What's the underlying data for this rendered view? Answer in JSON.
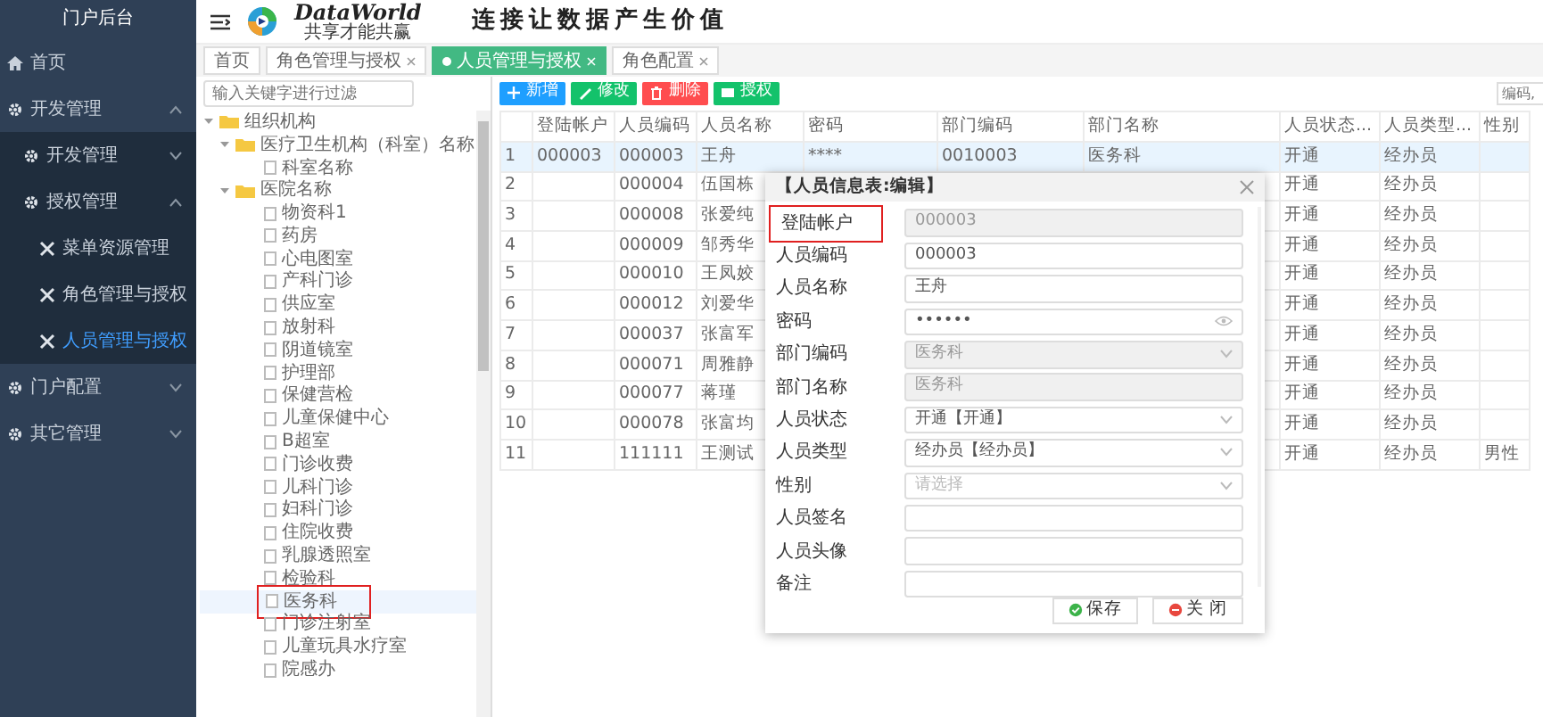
{
  "sidebar": {
    "title": "门户后台",
    "items": [
      {
        "label": "首页",
        "kind": "page"
      },
      {
        "label": "开发管理",
        "kind": "group",
        "expanded": true,
        "children": [
          {
            "label": "开发管理",
            "kind": "group",
            "expanded": false
          },
          {
            "label": "授权管理",
            "kind": "group",
            "expanded": true,
            "children": [
              {
                "label": "菜单资源管理",
                "kind": "function",
                "selected": false
              },
              {
                "label": "角色管理与授权",
                "kind": "function",
                "selected": false
              },
              {
                "label": "人员管理与授权",
                "kind": "function",
                "selected": true
              }
            ]
          }
        ]
      },
      {
        "label": "门户配置",
        "kind": "group",
        "expanded": false
      },
      {
        "label": "其它管理",
        "kind": "group",
        "expanded": false
      }
    ]
  },
  "header": {
    "logo": {
      "name": "DataWorld",
      "tagline": "共享才能共赢"
    },
    "slogan": "连接让数据产生价值"
  },
  "tabs": [
    {
      "label": "首页",
      "selected": false,
      "closable": false
    },
    {
      "label": "角色管理与授权",
      "selected": false,
      "closable": true
    },
    {
      "label": "人员管理与授权",
      "selected": true,
      "closable": true
    },
    {
      "label": "角色配置",
      "selected": false,
      "closable": true
    }
  ],
  "tree": {
    "filter_placeholder": "输入关键字进行过滤",
    "nodes": [
      {
        "label": "组织机构",
        "kind": "folder",
        "expanded": true,
        "children": [
          {
            "label": "医疗卫生机构（科室）名称",
            "kind": "folder",
            "expanded": true,
            "children": [
              {
                "label": "科室名称",
                "kind": "leaf",
                "selected": false,
                "highlighted": false
              }
            ]
          },
          {
            "label": "医院名称",
            "kind": "folder",
            "expanded": true,
            "children": [
              {
                "label": "物资科1",
                "kind": "leaf",
                "selected": false,
                "highlighted": false
              },
              {
                "label": "药房",
                "kind": "leaf",
                "selected": false,
                "highlighted": false
              },
              {
                "label": "心电图室",
                "kind": "leaf",
                "selected": false,
                "highlighted": false
              },
              {
                "label": "产科门诊",
                "kind": "leaf",
                "selected": false,
                "highlighted": false
              },
              {
                "label": "供应室",
                "kind": "leaf",
                "selected": false,
                "highlighted": false
              },
              {
                "label": "放射科",
                "kind": "leaf",
                "selected": false,
                "highlighted": false
              },
              {
                "label": "阴道镜室",
                "kind": "leaf",
                "selected": false,
                "highlighted": false
              },
              {
                "label": "护理部",
                "kind": "leaf",
                "selected": false,
                "highlighted": false
              },
              {
                "label": "保健营检",
                "kind": "leaf",
                "selected": false,
                "highlighted": false
              },
              {
                "label": "儿童保健中心",
                "kind": "leaf",
                "selected": false,
                "highlighted": false
              },
              {
                "label": "B超室",
                "kind": "leaf",
                "selected": false,
                "highlighted": false
              },
              {
                "label": "门诊收费",
                "kind": "leaf",
                "selected": false,
                "highlighted": false
              },
              {
                "label": "儿科门诊",
                "kind": "leaf",
                "selected": false,
                "highlighted": false
              },
              {
                "label": "妇科门诊",
                "kind": "leaf",
                "selected": false,
                "highlighted": false
              },
              {
                "label": "住院收费",
                "kind": "leaf",
                "selected": false,
                "highlighted": false
              },
              {
                "label": "乳腺透照室",
                "kind": "leaf",
                "selected": false,
                "highlighted": false
              },
              {
                "label": "检验科",
                "kind": "leaf",
                "selected": false,
                "highlighted": false
              },
              {
                "label": "医务科",
                "kind": "leaf",
                "selected": true,
                "highlighted": true
              },
              {
                "label": "门诊注射室",
                "kind": "leaf",
                "selected": false,
                "highlighted": false
              },
              {
                "label": "儿童玩具水疗室",
                "kind": "leaf",
                "selected": false,
                "highlighted": false
              },
              {
                "label": "院感办",
                "kind": "leaf",
                "selected": false,
                "highlighted": false
              }
            ]
          }
        ]
      }
    ]
  },
  "toolbar": {
    "buttons": [
      {
        "label": "新增",
        "kind": "add"
      },
      {
        "label": "修改",
        "kind": "edit"
      },
      {
        "label": "删除",
        "kind": "delete"
      },
      {
        "label": "授权",
        "kind": "grant"
      }
    ],
    "search_placeholder": "编码,"
  },
  "table": {
    "columns": [
      "登陆帐户",
      "人员编码",
      "人员名称",
      "密码",
      "部门编码",
      "部门名称",
      "人员状态...",
      "人员类型...",
      "性别"
    ],
    "rows": [
      {
        "index": "1",
        "selected": true,
        "cells": [
          "000003",
          "000003",
          "王舟",
          "****",
          "0010003",
          "医务科",
          "开通",
          "经办员",
          null
        ]
      },
      {
        "index": "2",
        "selected": false,
        "cells": [
          null,
          "000004",
          "伍国栋",
          null,
          null,
          null,
          "开通",
          "经办员",
          null
        ]
      },
      {
        "index": "3",
        "selected": false,
        "cells": [
          null,
          "000008",
          "张爱纯",
          null,
          null,
          null,
          "开通",
          "经办员",
          null
        ]
      },
      {
        "index": "4",
        "selected": false,
        "cells": [
          null,
          "000009",
          "邹秀华",
          null,
          null,
          null,
          "开通",
          "经办员",
          null
        ]
      },
      {
        "index": "5",
        "selected": false,
        "cells": [
          null,
          "000010",
          "王凤姣",
          null,
          null,
          null,
          "开通",
          "经办员",
          null
        ]
      },
      {
        "index": "6",
        "selected": false,
        "cells": [
          null,
          "000012",
          "刘爱华",
          null,
          null,
          null,
          "开通",
          "经办员",
          null
        ]
      },
      {
        "index": "7",
        "selected": false,
        "cells": [
          null,
          "000037",
          "张富军",
          null,
          null,
          null,
          "开通",
          "经办员",
          null
        ]
      },
      {
        "index": "8",
        "selected": false,
        "cells": [
          null,
          "000071",
          "周雅静",
          null,
          null,
          null,
          "开通",
          "经办员",
          null
        ]
      },
      {
        "index": "9",
        "selected": false,
        "cells": [
          null,
          "000077",
          "蒋瑾",
          null,
          null,
          null,
          "开通",
          "经办员",
          null
        ]
      },
      {
        "index": "10",
        "selected": false,
        "cells": [
          null,
          "000078",
          "张富均",
          null,
          null,
          null,
          "开通",
          "经办员",
          null
        ]
      },
      {
        "index": "11",
        "selected": false,
        "cells": [
          null,
          "111111",
          "王测试",
          null,
          null,
          null,
          "开通",
          "经办员",
          "男性"
        ]
      }
    ]
  },
  "dialog": {
    "title": "【人员信息表:编辑】",
    "fields": [
      {
        "label": "登陆帐户",
        "kind": "text",
        "value": "000003",
        "disabled": true,
        "highlighted": true
      },
      {
        "label": "人员编码",
        "kind": "text",
        "value": "000003",
        "disabled": false,
        "highlighted": false
      },
      {
        "label": "人员名称",
        "kind": "text",
        "value": "王舟",
        "disabled": false,
        "highlighted": false
      },
      {
        "label": "密码",
        "kind": "password",
        "value": "••••••",
        "disabled": false,
        "highlighted": false
      },
      {
        "label": "部门编码",
        "kind": "select",
        "value": "医务科",
        "disabled": true,
        "highlighted": false
      },
      {
        "label": "部门名称",
        "kind": "text",
        "value": "医务科",
        "disabled": true,
        "highlighted": false
      },
      {
        "label": "人员状态",
        "kind": "select",
        "value": "开通【开通】",
        "disabled": false,
        "highlighted": false
      },
      {
        "label": "人员类型",
        "kind": "select",
        "value": "经办员【经办员】",
        "disabled": false,
        "highlighted": false
      },
      {
        "label": "性别",
        "kind": "select",
        "placeholder": "请选择",
        "disabled": false,
        "highlighted": false
      },
      {
        "label": "人员签名",
        "kind": "text",
        "disabled": false,
        "highlighted": false
      },
      {
        "label": "人员头像",
        "kind": "text",
        "disabled": false,
        "highlighted": false
      },
      {
        "label": "备注",
        "kind": "text",
        "disabled": false,
        "highlighted": false
      }
    ],
    "buttons": [
      {
        "label": "保存",
        "kind": "save"
      },
      {
        "label": "关 闭",
        "kind": "close"
      }
    ]
  }
}
